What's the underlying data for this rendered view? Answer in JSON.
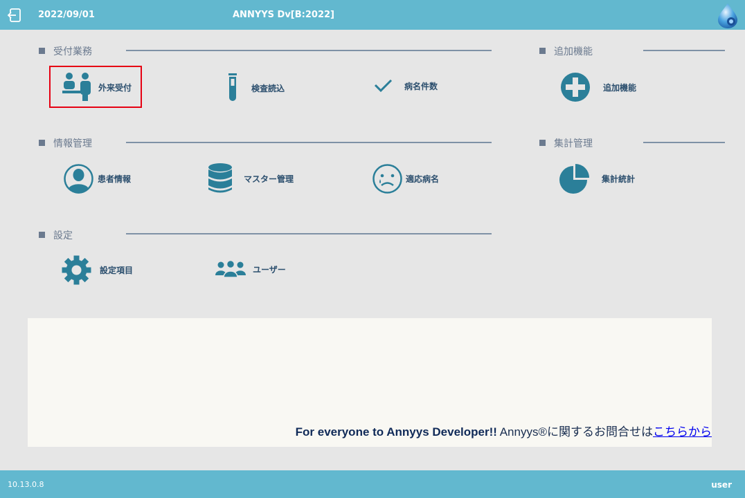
{
  "header": {
    "date": "2022/09/01",
    "title": "ANNYYS Dv[B:2022]"
  },
  "sections": {
    "reception": {
      "title": "受付業務"
    },
    "additional": {
      "title": "追加機能"
    },
    "info": {
      "title": "情報管理"
    },
    "aggregate": {
      "title": "集計管理"
    },
    "settings": {
      "title": "設定"
    }
  },
  "items": {
    "outpatient": "外来受付",
    "lab_import": "検査読込",
    "disease_count": "病名件数",
    "add_feature": "追加機能",
    "patient_info": "患者情報",
    "master_mgmt": "マスター管理",
    "proper_disease": "適応病名",
    "stats": "集計統計",
    "settings_items": "設定項目",
    "user": "ユーザー"
  },
  "icons": {
    "outpatient": "reception-desk-icon",
    "lab_import": "test-tube-icon",
    "disease_count": "checkmark-icon",
    "add_feature": "plus-circle-icon",
    "patient_info": "patient-icon",
    "master_mgmt": "database-icon",
    "proper_disease": "sad-face-icon",
    "stats": "pie-chart-icon",
    "settings_items": "gear-icon",
    "user": "users-icon"
  },
  "notice": {
    "bold": "For everyone to Annyys Developer!!",
    "text": " Annyys®に関するお問合せは",
    "link": "こちらから"
  },
  "footer": {
    "version": "10.13.0.8",
    "user": "user"
  },
  "colors": {
    "bar": "#62b8cf",
    "icon": "#2b7f99",
    "highlight": "#e60012"
  }
}
